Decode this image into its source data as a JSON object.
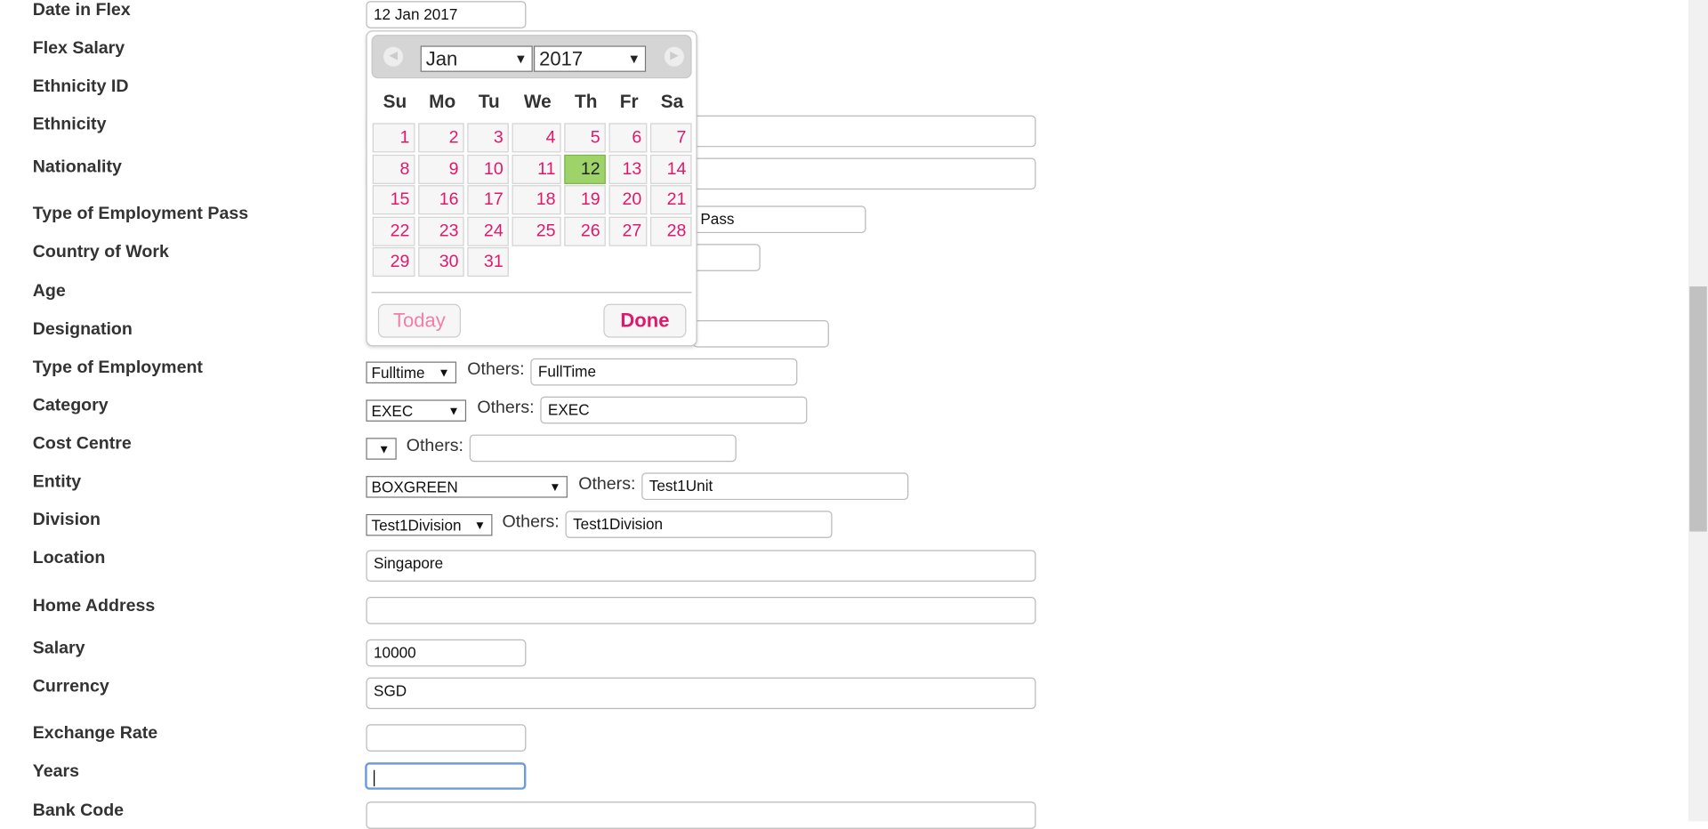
{
  "labels": [
    "Date in Flex",
    "Flex Salary",
    "Ethnicity ID",
    "Ethnicity",
    "Nationality",
    "Type of Employment Pass",
    "Country of Work",
    "Age",
    "Designation",
    "Type of Employment",
    "Category",
    "Cost Centre",
    "Entity",
    "Division",
    "Location",
    "Home Address",
    "Salary",
    "Currency",
    "Exchange Rate",
    "Years",
    "Bank Code"
  ],
  "fields": {
    "date_in_flex": "12 Jan 2017",
    "employment_pass_partial": "Pass",
    "type_of_employment_select": "Fulltime",
    "type_of_employment_others": "FullTime",
    "category_select": "EXEC",
    "category_others": "EXEC",
    "cost_centre_select": "",
    "cost_centre_others": "",
    "entity_select": "BOXGREEN",
    "entity_others": "Test1Unit",
    "division_select": "Test1Division",
    "division_others": "Test1Division",
    "location": "Singapore",
    "home_address": "",
    "salary": "10000",
    "currency": "SGD",
    "exchange_rate": "",
    "years": "",
    "bank_code": ""
  },
  "others_label": "Others:",
  "select_arrow": "▼",
  "datepicker": {
    "month": "Jan",
    "year": "2017",
    "prev_icon": "prev-arrow-icon",
    "next_icon": "next-arrow-icon",
    "days_of_week": [
      "Su",
      "Mo",
      "Tu",
      "We",
      "Th",
      "Fr",
      "Sa"
    ],
    "first_weekday": 0,
    "days_in_month": 31,
    "selected_day": 12,
    "today_label": "Today",
    "done_label": "Done"
  },
  "colors": {
    "day_text": "#e0186c",
    "selected_day_bg": "#9ed36a",
    "focus_border": "#6e9be0"
  }
}
